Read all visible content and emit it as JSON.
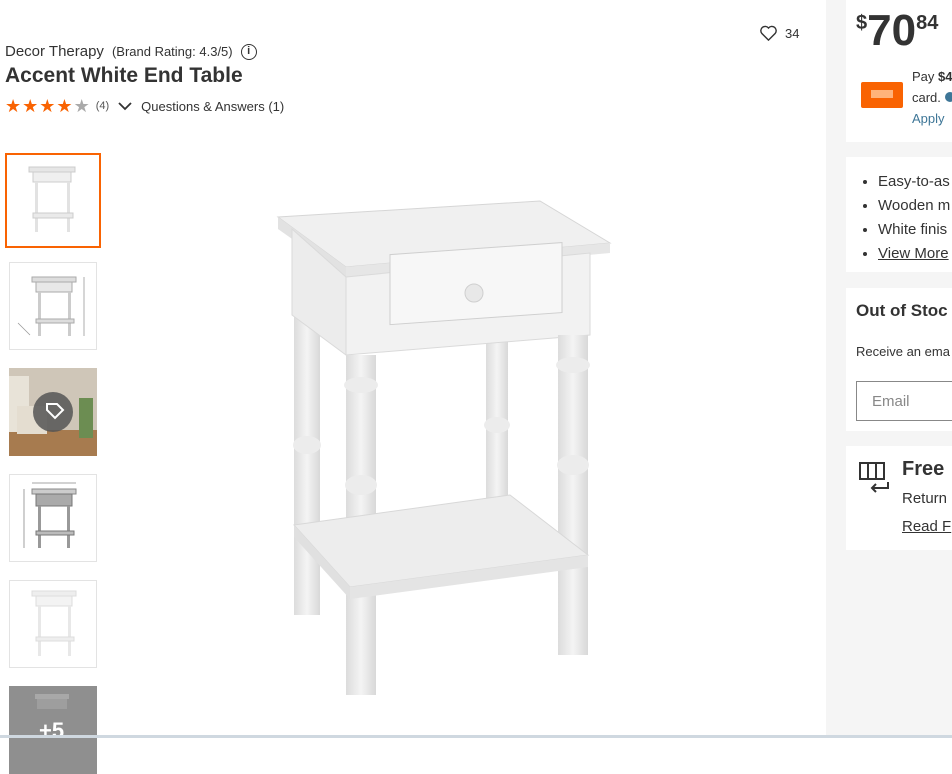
{
  "product": {
    "brand": "Decor Therapy",
    "brand_rating": "(Brand Rating: 4.3/5)",
    "title": "Accent White End Table",
    "rating_stars": 4,
    "review_count": "(4)",
    "qa_label": "Questions & Answers (1)",
    "favorite_count": "34",
    "more_images": "+5"
  },
  "price": {
    "currency": "$",
    "dollars": "70",
    "cents": "84"
  },
  "credit": {
    "pay_prefix": "Pay ",
    "pay_amount": "$4",
    "card_text": "card.",
    "apply_label": "Apply"
  },
  "highlights": [
    "Easy-to-as",
    "Wooden m",
    "White finis"
  ],
  "view_more": "View More",
  "stock": {
    "title": "Out of Stoc",
    "subtitle": "Receive an ema",
    "email_placeholder": "Email"
  },
  "returns": {
    "title": "Free",
    "subtitle": "Return",
    "link": "Read F"
  },
  "colors": {
    "accent": "#f96302",
    "text": "#333333",
    "link": "#3e7697",
    "panel_bg": "#f5f5f5"
  }
}
